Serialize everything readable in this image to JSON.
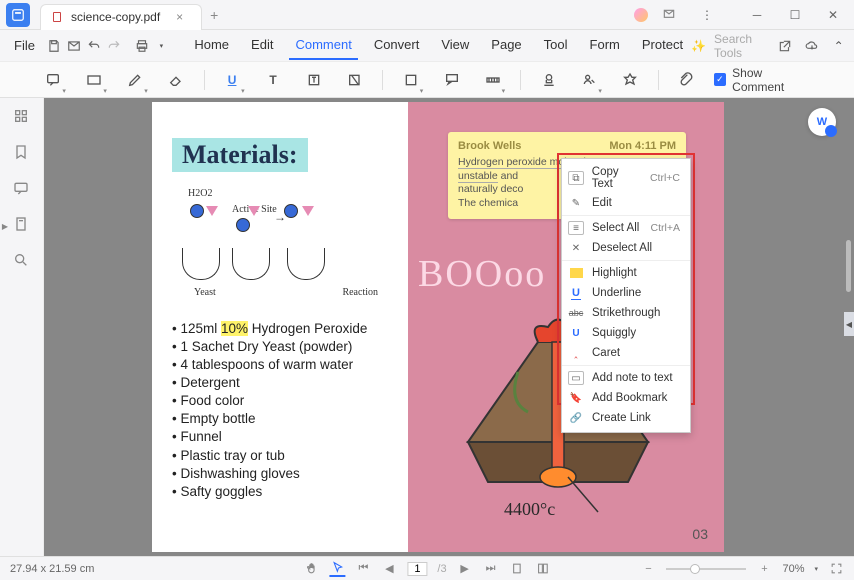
{
  "titlebar": {
    "filename": "science-copy.pdf"
  },
  "menubar": {
    "file": "File",
    "tabs": [
      "Home",
      "Edit",
      "Comment",
      "Convert",
      "View",
      "Page",
      "Tool",
      "Form",
      "Protect"
    ],
    "active_index": 2,
    "search_placeholder": "Search Tools"
  },
  "toolbar": {
    "show_comment": "Show Comment"
  },
  "page": {
    "materials_title": "Materials:",
    "diagram": {
      "h2o2": "H2O2",
      "active_site": "Active Site",
      "yeast": "Yeast",
      "reaction": "Reaction"
    },
    "materials_list": [
      {
        "pre": "125ml ",
        "hl": "10%",
        "post": " Hydrogen Peroxide"
      },
      {
        "pre": "1 Sachet Dry Yeast (powder)",
        "hl": "",
        "post": ""
      },
      {
        "pre": "4 tablespoons of warm water",
        "hl": "",
        "post": ""
      },
      {
        "pre": "Detergent",
        "hl": "",
        "post": ""
      },
      {
        "pre": "Food color",
        "hl": "",
        "post": ""
      },
      {
        "pre": "Empty bottle",
        "hl": "",
        "post": ""
      },
      {
        "pre": "Funnel",
        "hl": "",
        "post": ""
      },
      {
        "pre": "Plastic tray or tub",
        "hl": "",
        "post": ""
      },
      {
        "pre": "Dishwashing gloves",
        "hl": "",
        "post": ""
      },
      {
        "pre": "Safty goggles",
        "hl": "",
        "post": ""
      }
    ],
    "sticky": {
      "author": "Brook Wells",
      "timestamp": "Mon 4:11 PM",
      "line1_sel": "Hydrogen peroxide molecules are very unstable",
      "line1_rest": " and",
      "line2": "naturally deco",
      "line3": "The chemica"
    },
    "boo_text": "BOOoo",
    "temp_label": "4400°c",
    "page_number": "03"
  },
  "context_menu": {
    "items": [
      {
        "icon": "copy",
        "label": "Copy Text",
        "shortcut": "Ctrl+C"
      },
      {
        "icon": "edit",
        "label": "Edit",
        "shortcut": ""
      },
      {
        "icon": "selectall",
        "label": "Select All",
        "shortcut": "Ctrl+A"
      },
      {
        "icon": "deselect",
        "label": "Deselect All",
        "shortcut": ""
      },
      {
        "icon": "highlight",
        "label": "Highlight",
        "shortcut": ""
      },
      {
        "icon": "underline",
        "label": "Underline",
        "shortcut": ""
      },
      {
        "icon": "strike",
        "label": "Strikethrough",
        "shortcut": ""
      },
      {
        "icon": "squiggly",
        "label": "Squiggly",
        "shortcut": ""
      },
      {
        "icon": "caret",
        "label": "Caret",
        "shortcut": ""
      },
      {
        "icon": "note",
        "label": "Add note to text",
        "shortcut": ""
      },
      {
        "icon": "bookmark",
        "label": "Add Bookmark",
        "shortcut": ""
      },
      {
        "icon": "link",
        "label": "Create Link",
        "shortcut": ""
      }
    ]
  },
  "statusbar": {
    "dims": "27.94 x 21.59 cm",
    "page_current": "1",
    "page_total": "/3",
    "zoom": "70%"
  }
}
